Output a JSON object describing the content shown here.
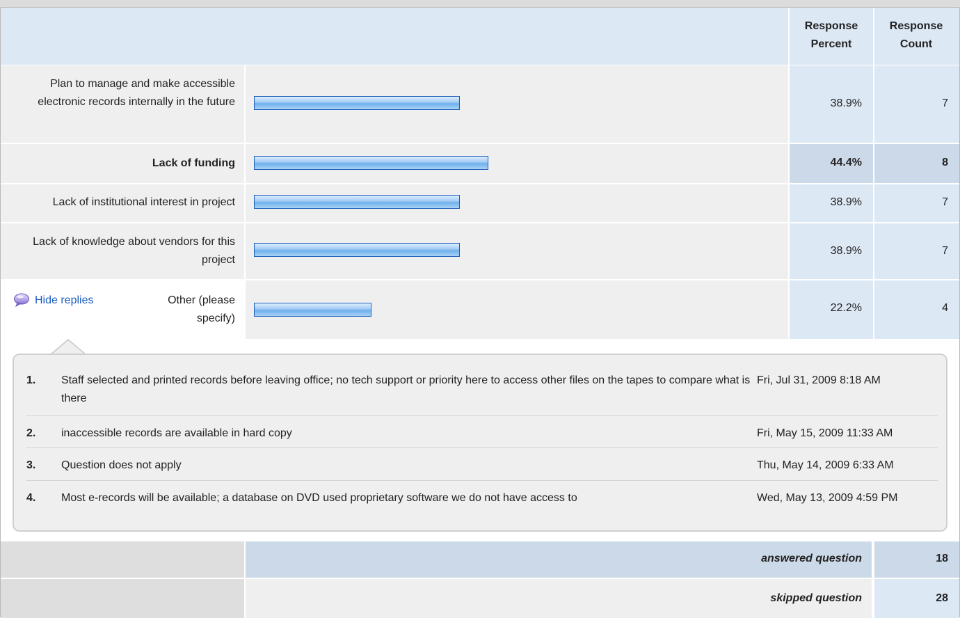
{
  "header": {
    "col_percent": "Response Percent",
    "col_count": "Response Count"
  },
  "rows": [
    {
      "label": "Plan to manage and make accessible electronic records internally in the future",
      "percent": "38.9%",
      "count": "7",
      "value": 38.9
    },
    {
      "label": "Lack of funding",
      "percent": "44.4%",
      "count": "8",
      "value": 44.4,
      "highlight": true
    },
    {
      "label": "Lack of institutional interest in project",
      "percent": "38.9%",
      "count": "7",
      "value": 38.9
    },
    {
      "label": "Lack of knowledge about vendors for this project",
      "percent": "38.9%",
      "count": "7",
      "value": 38.9
    },
    {
      "label": "Other (please specify)",
      "percent": "22.2%",
      "count": "4",
      "value": 22.2
    }
  ],
  "other": {
    "hide_replies": "Hide replies"
  },
  "replies": [
    {
      "num": "1.",
      "text": "Staff selected and printed records before leaving office; no tech support or priority here to access other files on the tapes to compare what is there",
      "date": "Fri, Jul 31, 2009 8:18 AM"
    },
    {
      "num": "2.",
      "text": "inaccessible records are available in hard copy",
      "date": "Fri, May 15, 2009 11:33 AM"
    },
    {
      "num": "3.",
      "text": "Question does not apply",
      "date": "Thu, May 14, 2009 6:33 AM"
    },
    {
      "num": "4.",
      "text": "Most e-records will be available; a database on DVD used proprietary software we do not have access to",
      "date": "Wed, May 13, 2009 4:59 PM"
    }
  ],
  "summary": {
    "answered_label": "answered question",
    "answered_value": "18",
    "skipped_label": "skipped question",
    "skipped_value": "28"
  },
  "colors": {
    "header_bg": "#dde8f5",
    "bar_border": "#1b5db8",
    "link": "#1a5ec2"
  }
}
